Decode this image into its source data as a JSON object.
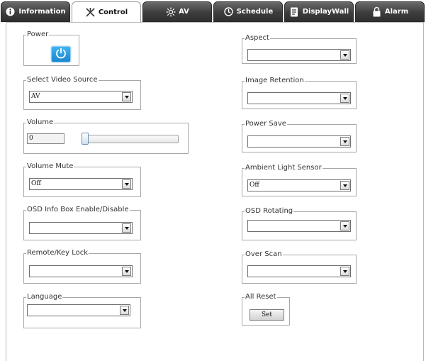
{
  "tabs": [
    {
      "label": "Information",
      "icon": "info-icon",
      "active": false
    },
    {
      "label": "Control",
      "icon": "tools-icon",
      "active": true
    },
    {
      "label": "AV",
      "icon": "sun-icon",
      "active": false
    },
    {
      "label": "Schedule",
      "icon": "clock-icon",
      "active": false
    },
    {
      "label": "DisplayWall",
      "icon": "document-icon",
      "active": false
    },
    {
      "label": "Alarm",
      "icon": "lock-icon",
      "active": false
    }
  ],
  "left": {
    "power": {
      "legend": "Power"
    },
    "video_source": {
      "legend": "Select Video Source",
      "value": "AV"
    },
    "volume": {
      "legend": "Volume",
      "value": "0",
      "level": 0
    },
    "volume_mute": {
      "legend": "Volume Mute",
      "value": "Off"
    },
    "osd_info_box": {
      "legend": "OSD Info Box Enable/Disable",
      "value": ""
    },
    "remote_key_lock": {
      "legend": "Remote/Key Lock",
      "value": ""
    },
    "language": {
      "legend": "Language",
      "value": ""
    }
  },
  "right": {
    "aspect": {
      "legend": "Aspect",
      "value": ""
    },
    "image_retention": {
      "legend": "Image Retention",
      "value": ""
    },
    "power_save": {
      "legend": "Power Save",
      "value": ""
    },
    "ambient_light": {
      "legend": "Ambient Light Sensor",
      "value": "Off"
    },
    "osd_rotating": {
      "legend": "OSD Rotating",
      "value": ""
    },
    "over_scan": {
      "legend": "Over Scan",
      "value": ""
    },
    "all_reset": {
      "legend": "All Reset",
      "button": "Set"
    }
  },
  "colors": {
    "tab_dark": "#3d3d3d",
    "power_blue": "#1a86cf",
    "border": "#a8a8a8"
  }
}
